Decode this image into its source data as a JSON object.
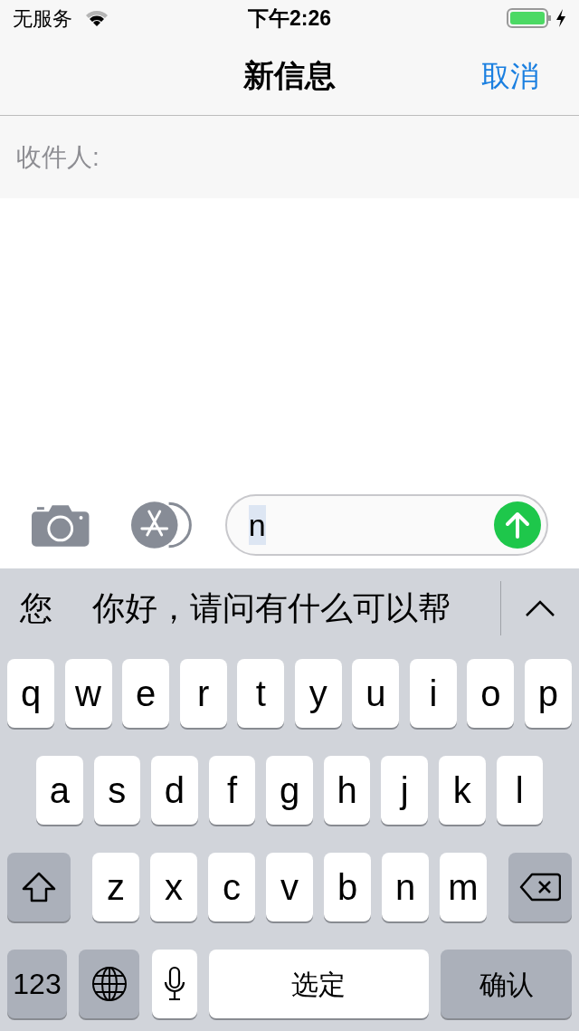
{
  "status_bar": {
    "carrier": "无服务",
    "time": "下午2:26"
  },
  "nav": {
    "title": "新信息",
    "cancel": "取消"
  },
  "recipient": {
    "label": "收件人:"
  },
  "compose": {
    "value": "n"
  },
  "candidates": [
    "您",
    "你好，请问有什么可以帮"
  ],
  "keyboard": [
    [
      {
        "kind": "letter",
        "label": "q"
      },
      {
        "kind": "letter",
        "label": "w"
      },
      {
        "kind": "letter",
        "label": "e"
      },
      {
        "kind": "letter",
        "label": "r"
      },
      {
        "kind": "letter",
        "label": "t"
      },
      {
        "kind": "letter",
        "label": "y"
      },
      {
        "kind": "letter",
        "label": "u"
      },
      {
        "kind": "letter",
        "label": "i"
      },
      {
        "kind": "letter",
        "label": "o"
      },
      {
        "kind": "letter",
        "label": "p"
      }
    ],
    [
      {
        "kind": "letter",
        "label": "a"
      },
      {
        "kind": "letter",
        "label": "s"
      },
      {
        "kind": "letter",
        "label": "d"
      },
      {
        "kind": "letter",
        "label": "f"
      },
      {
        "kind": "letter",
        "label": "g"
      },
      {
        "kind": "letter",
        "label": "h"
      },
      {
        "kind": "letter",
        "label": "j"
      },
      {
        "kind": "letter",
        "label": "k"
      },
      {
        "kind": "letter",
        "label": "l"
      }
    ],
    [
      {
        "kind": "shift"
      },
      {
        "kind": "letter",
        "label": "z"
      },
      {
        "kind": "letter",
        "label": "x"
      },
      {
        "kind": "letter",
        "label": "c"
      },
      {
        "kind": "letter",
        "label": "v"
      },
      {
        "kind": "letter",
        "label": "b"
      },
      {
        "kind": "letter",
        "label": "n"
      },
      {
        "kind": "letter",
        "label": "m"
      },
      {
        "kind": "delete"
      }
    ],
    [
      {
        "kind": "numbers",
        "label": "123"
      },
      {
        "kind": "globe"
      },
      {
        "kind": "mic"
      },
      {
        "kind": "space",
        "label": "选定"
      },
      {
        "kind": "return",
        "label": "确认"
      }
    ]
  ]
}
